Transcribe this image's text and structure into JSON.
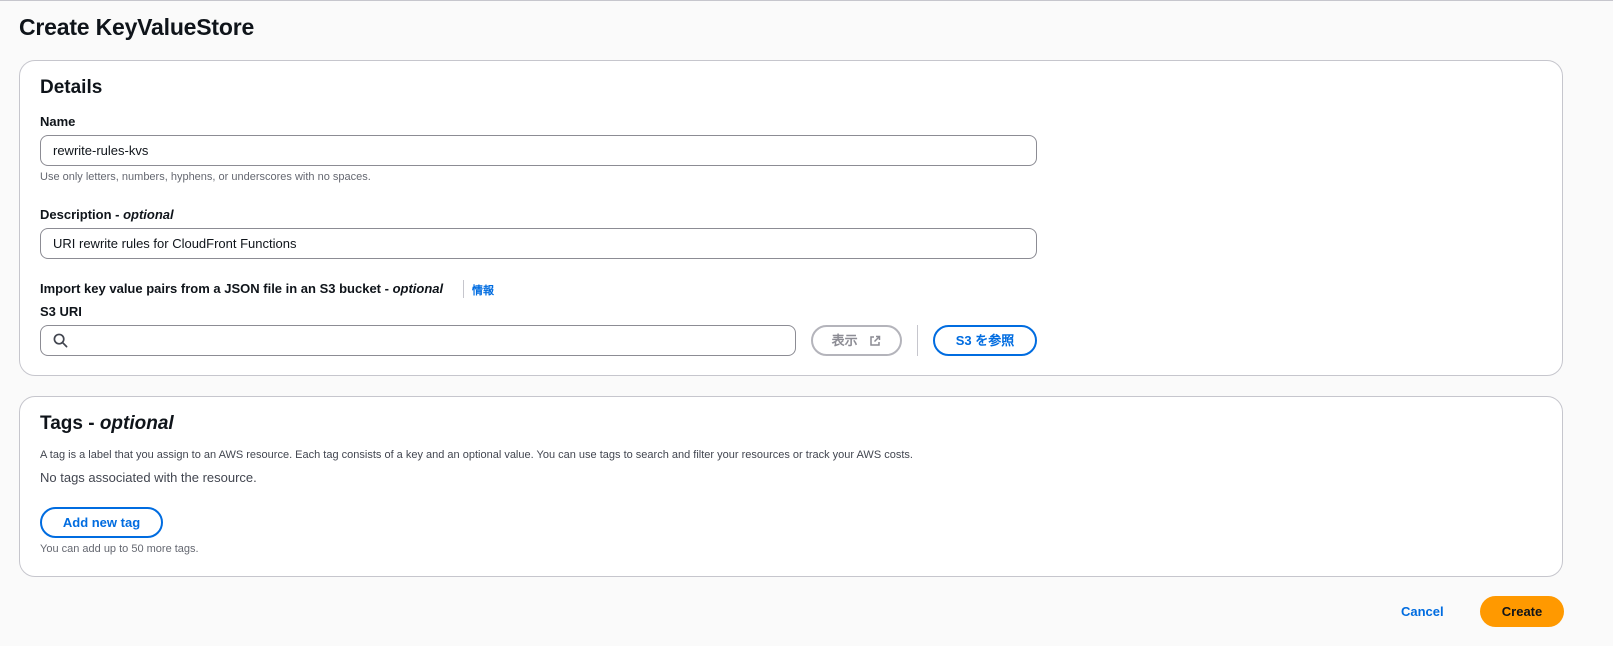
{
  "page": {
    "title": "Create KeyValueStore"
  },
  "details": {
    "heading": "Details",
    "name": {
      "label": "Name",
      "value": "rewrite-rules-kvs",
      "hint": "Use only letters, numbers, hyphens, or underscores with no spaces."
    },
    "description": {
      "label": "Description - ",
      "optional": "optional",
      "value": "URI rewrite rules for CloudFront Functions"
    },
    "import": {
      "label": "Import key value pairs from a JSON file in an S3 bucket - ",
      "optional": "optional",
      "info_link": "情報",
      "s3_uri_label": "S3 URI",
      "s3_uri_value": "",
      "view_button": "表示",
      "browse_button": "S3 を参照"
    }
  },
  "tags": {
    "heading": "Tags - ",
    "optional": "optional",
    "description": "A tag is a label that you assign to an AWS resource. Each tag consists of a key and an optional value. You can use tags to search and filter your resources or track your AWS costs.",
    "empty": "No tags associated with the resource.",
    "add_button": "Add new tag",
    "limit_hint": "You can add up to 50 more tags."
  },
  "footer": {
    "cancel": "Cancel",
    "create": "Create"
  },
  "colors": {
    "primary": "#006ce0",
    "create_button": "#ff9900",
    "border": "#c6c6cd"
  },
  "icons": {
    "search": "search-icon",
    "external": "external-link-icon"
  }
}
